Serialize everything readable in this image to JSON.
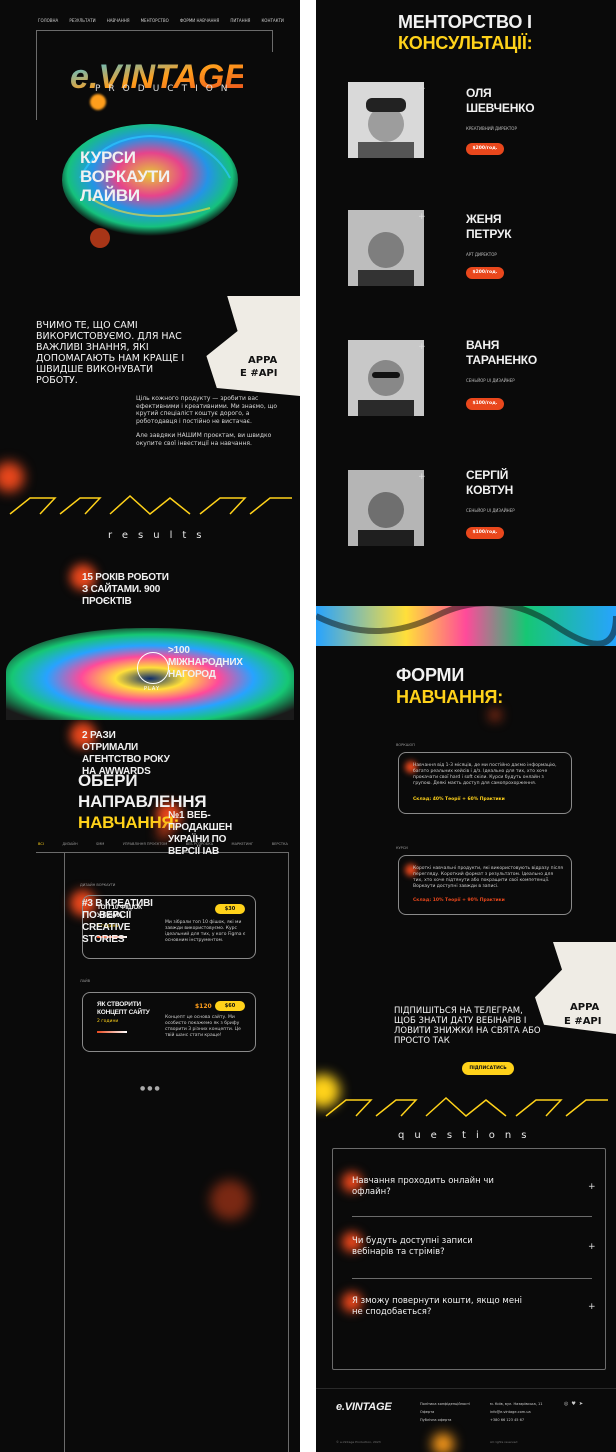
{
  "nav": [
    "ГОЛОВНА",
    "РЕЗУЛЬТАТИ",
    "НАВЧАННЯ",
    "МЕНТОРСТВО",
    "ФОРМИ НАВЧАННЯ",
    "ПИТАННЯ",
    "КОНТАКТИ"
  ],
  "hero": {
    "logo": "e.VINTAGE",
    "tagline": "PRODUCTION",
    "title": [
      "КУРСИ",
      "ВОРКАУТИ",
      "ЛАЙВИ"
    ]
  },
  "about": {
    "lead": "ВЧИМО ТЕ, ЩО САМІ ВИКОРИСТОВУЄМО. ДЛЯ НАС ВАЖЛИВІ ЗНАННЯ, ЯКІ ДОПОМАГАЮТЬ НАМ КРАЩЕ І ШВИДШЕ ВИКОНУВАТИ РОБОТУ.",
    "p1": "Ціль кожного продукту — зробити вас ефективними і креативними. Ми знаємо, що крутий спеціаліст коштує дорого, а роботодавця і постійно не вистачає.",
    "p2": "Але завдяки НАШИМ проєктам, ви швидко окупите свої інвестиції на навчання.",
    "torn_text": [
      "APPA",
      "E #API"
    ]
  },
  "results": {
    "label": "results",
    "stats": [
      "15 РОКІВ РОБОТИ З САЙТАМИ. 900 ПРОЄКТІВ",
      ">100 МІЖНАРОДНИХ НАГОРОД",
      "2 РАЗИ ОТРИМАЛИ АГЕНТСТВО РОКУ НА AWWARDS",
      "№1 ВЕБ-ПРОДАКШЕН УКРАЇНИ ПО ВЕРСІЇ IAB",
      "#3 В КРЕАТИВІ ПО ВЕРСІЇ CREATIVE STORIES"
    ]
  },
  "video": {
    "play": "PLAY"
  },
  "choose": {
    "title": [
      "ОБЕРИ",
      "НАПРАВЛЕННЯ"
    ],
    "accent": "НАВЧАННЯ:",
    "tabs": [
      "ВСІ",
      "ДИЗАЙН",
      "SMM",
      "УПРАВЛІННЯ ПРОЄКТОМ",
      "ВЕБ РОЗРОБКА",
      "МАРКЕТИНГ",
      "ВЕРСТКА"
    ],
    "group1": "ДИЗАЙН ВОРКАУТИ",
    "group2": "ЛАЙВ",
    "card1": {
      "title": "ТОП 10 ФІШОК У FIGMA",
      "price": "$30",
      "time": "1 година",
      "desc": "Ми зібрали топ 10 фішок, які ми завжди використовуємо. Курс ідеальний для тих, у кого Figma є основним інструментом."
    },
    "card2": {
      "title": "ЯК СТВОРИТИ КОНЦЕПТ САЙТУ",
      "old_price": "$120",
      "price": "$60",
      "time": "2 години",
      "desc": "Концепт це основа сайту. Ми особисто покажемо як з брифу створити 3 різних концепти. Це твій шанс стати краще!"
    }
  },
  "mentor": {
    "title": [
      "МЕНТОРСТВО І"
    ],
    "accent": "КОНСУЛЬТАЦІЇ:",
    "people": [
      {
        "name": [
          "ОЛЯ",
          "ШЕВЧЕНКО"
        ],
        "role": "КРЕАТИВНИЙ ДИРЕКТОР",
        "price": "$200/год."
      },
      {
        "name": [
          "ЖЕНЯ",
          "ПЕТРУК"
        ],
        "role": "АРТ ДИРЕКТОР",
        "price": "$200/год."
      },
      {
        "name": [
          "ВАНЯ",
          "ТАРАНЕНКО"
        ],
        "role": "СЕНЬЙОР UI ДИЗАЙНЕР",
        "price": "$100/год."
      },
      {
        "name": [
          "СЕРГІЙ",
          "КОВТУН"
        ],
        "role": "СЕНЬЙОР UI ДИЗАЙНЕР",
        "price": "$100/год."
      }
    ]
  },
  "forms": {
    "title": "ФОРМИ",
    "accent": "НАВЧАННЯ:",
    "f1": {
      "tag": "ВОРКШОП",
      "text": "Навчання від 1-3 місяців, де ми постійно даємо інформацію, багато реальних кейсів і д/з. Ідеально для тих, хто хоче прокачати свої hard і soft скіли. Курси будуть онлайн з групою. Деякі маєть доступ для самопрохорження.",
      "detail": "Склад: 40% Теорії + 60% Практики"
    },
    "f2": {
      "tag": "КУРСИ",
      "text": "Короткі навчальні продукти, які використовують відразу після перегляду. Короткий формат з результатом. Ідеально для тих, хто хоче підтянути або покращити свої компетенції. Воркаути доступні завжди в записі.",
      "detail": "Склад: 10% Теорії + 90% Практики"
    }
  },
  "subscribe": {
    "text": "ПІДПИШІТЬСЯ НА ТЕЛЕГРАМ, ЩОБ ЗНАТИ ДАТУ ВЕБІНАРІВ І ЛОВИТИ ЗНИЖКИ НА СВЯТА АБО ПРОСТО ТАК",
    "button": "ПІДПИСАТИСЬ"
  },
  "questions": {
    "label": "questions",
    "items": [
      "Навчання проходить онлайн чи офлайн?",
      "Чи будуть доступні записи вебінарів та стрімів?",
      "Я зможу повернути кошти, якщо мені не сподобається?"
    ]
  },
  "footer": {
    "logo": "e.VINTAGE",
    "links": [
      "Політика конфіденційності",
      "Оферта",
      "Публічна оферта"
    ],
    "contacts": [
      "м. Київ, вул. Назарівська, 11",
      "info@e-vintage.com.ua",
      "+380 66 123 45 67"
    ],
    "copy": "© e-Vintage Production, 2023",
    "copy2": "All rights reserved"
  }
}
